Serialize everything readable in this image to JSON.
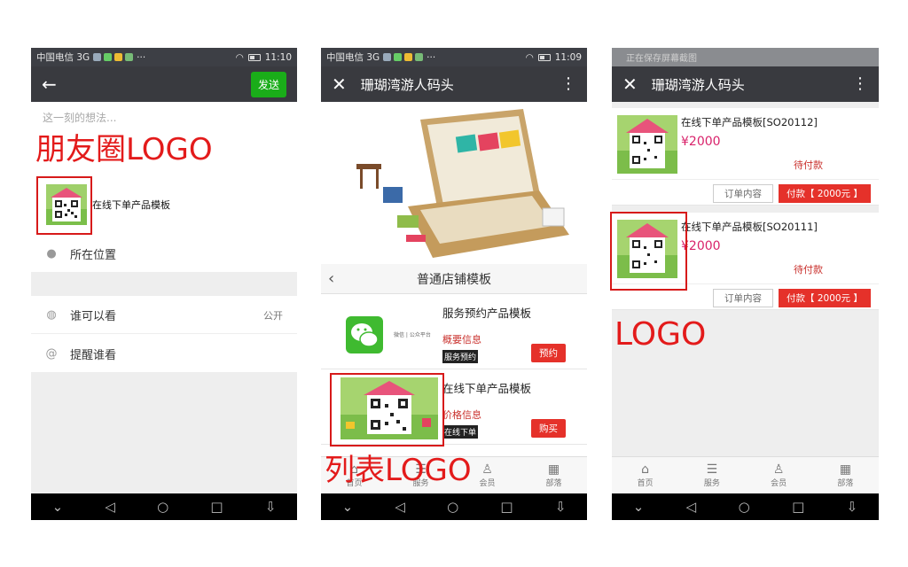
{
  "colors": {
    "wechat_green": "#1aad19",
    "accent_red": "#e5312a",
    "price_pink": "#d9236b",
    "annotation_red": "#e31b1b"
  },
  "status_bar": {
    "carrier": "中国电信 3G",
    "dots": "···",
    "phone1_time": "11:10",
    "phone2_time": "11:09"
  },
  "phone1": {
    "back_icon": "arrow-left-icon",
    "send_label": "发送",
    "thoughts_placeholder": "这一刻的想法...",
    "share_title": "在线下单产品模板",
    "location_label": "所在位置",
    "visibility_label": "谁可以看",
    "visibility_value": "公开",
    "remind_label": "提醒谁看",
    "annotation": "朋友圈LOGO"
  },
  "phone2": {
    "close_icon": "close-icon",
    "title": "珊瑚湾游人码头",
    "shop_title": "普通店铺模板",
    "products": [
      {
        "name": "服务预约产品模板",
        "info": "概要信息",
        "tag": "服务预约",
        "button": "预约",
        "thumb_caption": "微信 | 公众平台"
      },
      {
        "name": "在线下单产品模板",
        "info": "价格信息",
        "tag": "在线下单",
        "button": "购买"
      }
    ],
    "tabs": [
      "首页",
      "服务",
      "会员",
      "部落"
    ],
    "annotation": "列表LOGO"
  },
  "phone3": {
    "faded_notice": "正在保存屏幕截图",
    "title": "珊瑚湾游人码头",
    "orders": [
      {
        "name": "在线下单产品模板[SO20112]",
        "price": "¥2000",
        "status": "待付款",
        "detail_label": "订单内容",
        "pay_label": "付款【 2000元 】"
      },
      {
        "name": "在线下单产品模板[SO20111]",
        "price": "¥2000",
        "status": "待付款",
        "detail_label": "订单内容",
        "pay_label": "付款【 2000元 】"
      }
    ],
    "tabs": [
      "首页",
      "服务",
      "会员",
      "部落"
    ],
    "annotation": "LOGO"
  },
  "android_nav": [
    "chevron-down-icon",
    "back-triangle-icon",
    "home-circle-icon",
    "recents-square-icon",
    "notification-down-icon"
  ]
}
